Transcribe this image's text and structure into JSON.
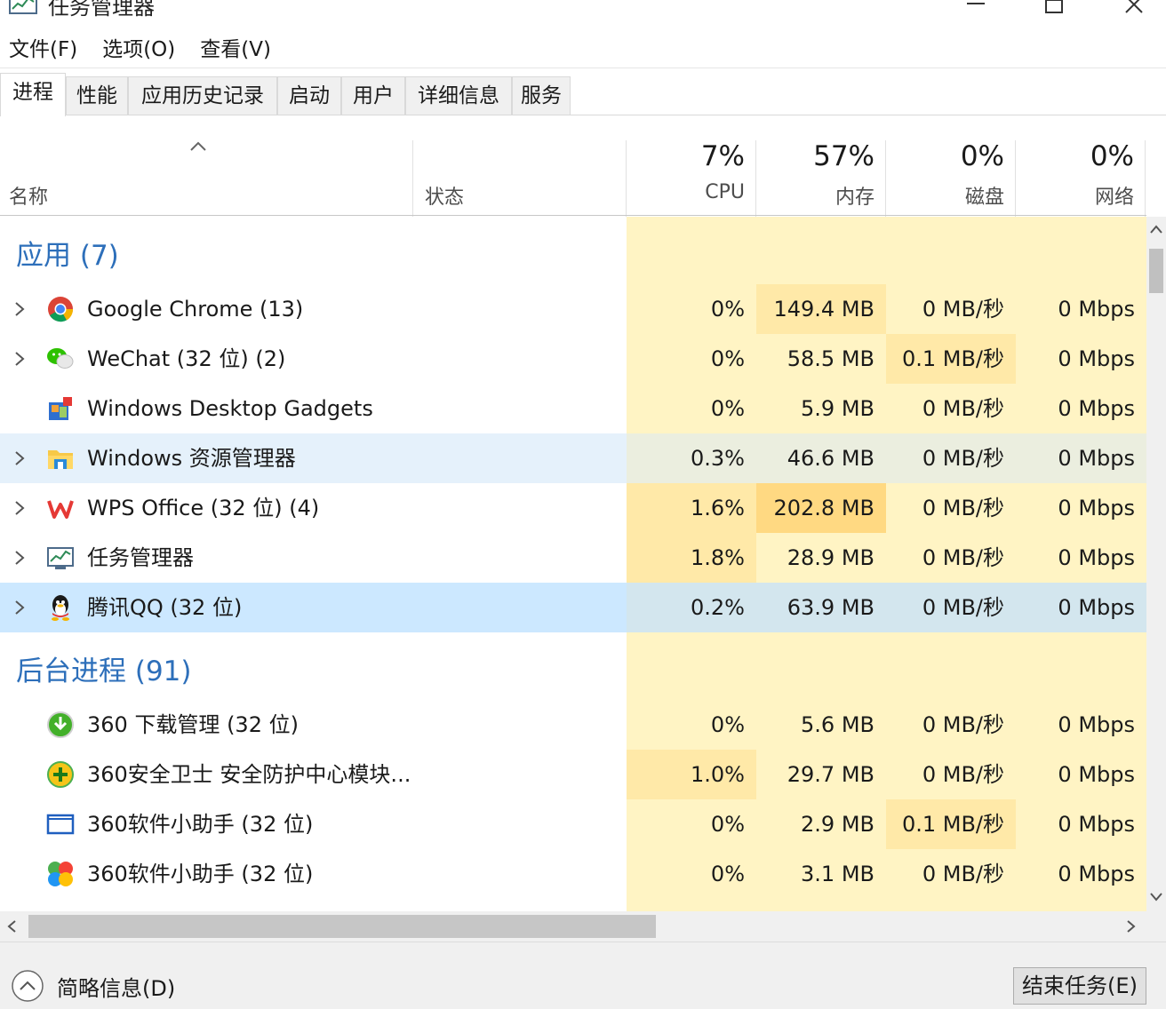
{
  "window": {
    "title": "任务管理器"
  },
  "menu": [
    "文件(F)",
    "选项(O)",
    "查看(V)"
  ],
  "tabs": [
    "进程",
    "性能",
    "应用历史记录",
    "启动",
    "用户",
    "详细信息",
    "服务"
  ],
  "active_tab": "进程",
  "header": {
    "name": "名称",
    "status": "状态",
    "cpu_pct": "7%",
    "cpu": "CPU",
    "mem_pct": "57%",
    "mem": "内存",
    "disk_pct": "0%",
    "disk": "磁盘",
    "net_pct": "0%",
    "net": "网络"
  },
  "groups": {
    "apps": "应用 (7)",
    "background": "后台进程 (91)"
  },
  "apps": [
    {
      "name": "Google Chrome (13)",
      "icon": "chrome-icon",
      "cpu": "0%",
      "mem": "149.4 MB",
      "disk": "0 MB/秒",
      "net": "0 Mbps"
    },
    {
      "name": "WeChat (32 位) (2)",
      "icon": "wechat-icon",
      "cpu": "0%",
      "mem": "58.5 MB",
      "disk": "0.1 MB/秒",
      "net": "0 Mbps"
    },
    {
      "name": "Windows Desktop Gadgets",
      "icon": "gadgets-icon",
      "cpu": "0%",
      "mem": "5.9 MB",
      "disk": "0 MB/秒",
      "net": "0 Mbps"
    },
    {
      "name": "Windows 资源管理器",
      "icon": "explorer-icon",
      "cpu": "0.3%",
      "mem": "46.6 MB",
      "disk": "0 MB/秒",
      "net": "0 Mbps"
    },
    {
      "name": "WPS Office (32 位) (4)",
      "icon": "wps-icon",
      "cpu": "1.6%",
      "mem": "202.8 MB",
      "disk": "0 MB/秒",
      "net": "0 Mbps"
    },
    {
      "name": "任务管理器",
      "icon": "task-manager-icon",
      "cpu": "1.8%",
      "mem": "28.9 MB",
      "disk": "0 MB/秒",
      "net": "0 Mbps"
    },
    {
      "name": "腾讯QQ (32 位)",
      "icon": "qq-icon",
      "cpu": "0.2%",
      "mem": "63.9 MB",
      "disk": "0 MB/秒",
      "net": "0 Mbps"
    }
  ],
  "background": [
    {
      "name": "360 下载管理 (32 位)",
      "icon": "download-icon",
      "cpu": "0%",
      "mem": "5.6 MB",
      "disk": "0 MB/秒",
      "net": "0 Mbps"
    },
    {
      "name": "360安全卫士 安全防护中心模块...",
      "icon": "360-security-icon",
      "cpu": "1.0%",
      "mem": "29.7 MB",
      "disk": "0 MB/秒",
      "net": "0 Mbps"
    },
    {
      "name": "360软件小助手 (32 位)",
      "icon": "window-icon",
      "cpu": "0%",
      "mem": "2.9 MB",
      "disk": "0.1 MB/秒",
      "net": "0 Mbps"
    },
    {
      "name": "360软件小助手 (32 位)",
      "icon": "360-assistant-icon",
      "cpu": "0%",
      "mem": "3.1 MB",
      "disk": "0 MB/秒",
      "net": "0 Mbps"
    }
  ],
  "footer": {
    "less_info": "简略信息(D)",
    "end_task": "结束任务(E)"
  },
  "colors": {
    "heat_light": "#fff4c4",
    "heat_medium": "#ffe9a8",
    "heat_strong": "#ffd982",
    "group_blue": "#2d6fba",
    "hover": "#e5f1fb",
    "selected": "#cce8ff"
  }
}
